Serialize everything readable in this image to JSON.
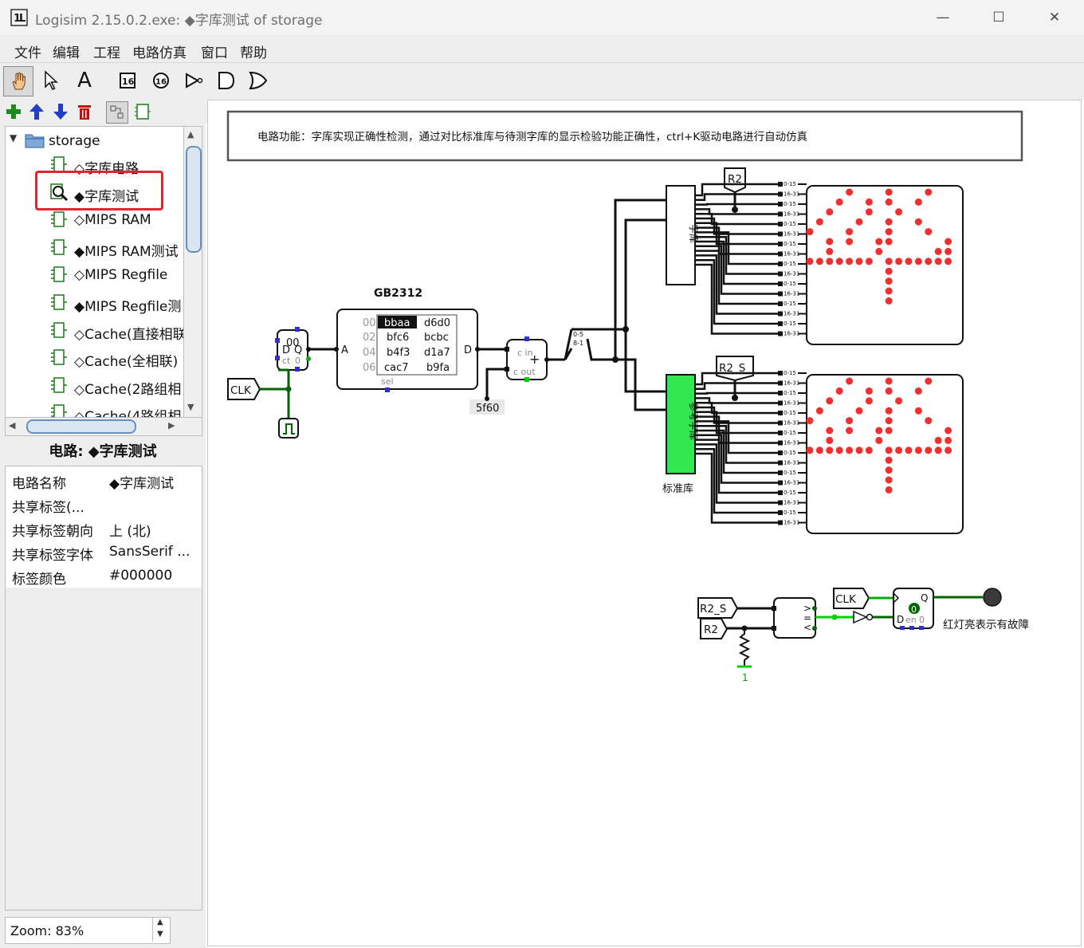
{
  "window": {
    "title": "Logisim 2.15.0.2.exe: ◆字库测试 of storage",
    "minimize": "—",
    "maximize": "☐",
    "close": "✕"
  },
  "menu": [
    "文件",
    "编辑",
    "工程",
    "电路仿真",
    "窗口",
    "帮助"
  ],
  "toolbar": {
    "text_tool": "A",
    "pin_label": "16",
    "icons": [
      "hand-poke-icon",
      "arrow-select-icon",
      "text-tool-icon",
      "input-pin-icon",
      "output-pin-icon",
      "not-gate-icon",
      "and-gate-icon",
      "or-gate-icon"
    ]
  },
  "subtoolbar": [
    "add-circuit-icon",
    "move-up-icon",
    "move-down-icon",
    "delete-circuit-icon",
    "layout-view-icon",
    "appearance-view-icon"
  ],
  "tree": {
    "root": "storage",
    "items": [
      {
        "label": "◇字库电路"
      },
      {
        "label": "◆字库测试",
        "selected": true
      },
      {
        "label": "◇MIPS RAM"
      },
      {
        "label": "◆MIPS RAM测试"
      },
      {
        "label": "◇MIPS Regfile"
      },
      {
        "label": "◆MIPS Regfile测"
      },
      {
        "label": "◇Cache(直接相联"
      },
      {
        "label": "◇Cache(全相联)"
      },
      {
        "label": "◇Cache(2路组相"
      },
      {
        "label": "◇Cache(4路组相"
      }
    ]
  },
  "properties": {
    "title": "电路: ◆字库测试",
    "rows": [
      {
        "key": "电路名称",
        "value": "◆字库测试"
      },
      {
        "key": "共享标签(...",
        "value": ""
      },
      {
        "key": "共享标签朝向",
        "value": "上 (北)"
      },
      {
        "key": "共享标签字体",
        "value": "SansSerif ..."
      },
      {
        "key": "标签颜色",
        "value": "#000000"
      }
    ]
  },
  "zoom": "Zoom: 83%",
  "circuit": {
    "description": "电路功能：字库实现正确性检测，通过对比标准库与待测字库的显示检验功能正确性，ctrl+K驱动电路进行自动仿真",
    "rom_title": "GB2312",
    "rom_addresses": [
      "00",
      "02",
      "04",
      "06"
    ],
    "rom_col1": [
      "bbaa",
      "bfc6",
      "b4f3",
      "cac7"
    ],
    "rom_col2": [
      "d6d0",
      "bcbc",
      "d1a7",
      "b9fa"
    ],
    "rom_port_a": "A",
    "rom_port_d": "D",
    "rom_sel": "sel",
    "counter_value": "00",
    "counter_d": "D",
    "counter_q": "Q",
    "counter_ct": "ct",
    "counter_zero": "0",
    "clk": "CLK",
    "constant": "5f60",
    "adder_cin": "c in",
    "adder_cout": "c out",
    "adder_plus": "+",
    "split_low": "0-5",
    "split_high": "8-1",
    "font_lib_label": "字库",
    "ref_lib_label": "参考字库",
    "std_lib_caption": "标准库",
    "tunnel_r2": "R2",
    "tunnel_r2s": "R2_S",
    "bus_a": "0-15",
    "bus_b": "16-31",
    "comparator_gt": ">",
    "comparator_eq": "=",
    "comparator_lt": "<",
    "reg_d": "D",
    "reg_q": "Q",
    "reg_en": "en",
    "reg_value": "0",
    "reg_zero": "0",
    "const_one": "1",
    "fault_label": "红灯亮表示有故障",
    "colors": {
      "wire_dark": "#006400",
      "wire_bright": "#00d200",
      "led": "#f03030",
      "ref_fill": "#32e650",
      "highlight": "#e5252c"
    }
  }
}
